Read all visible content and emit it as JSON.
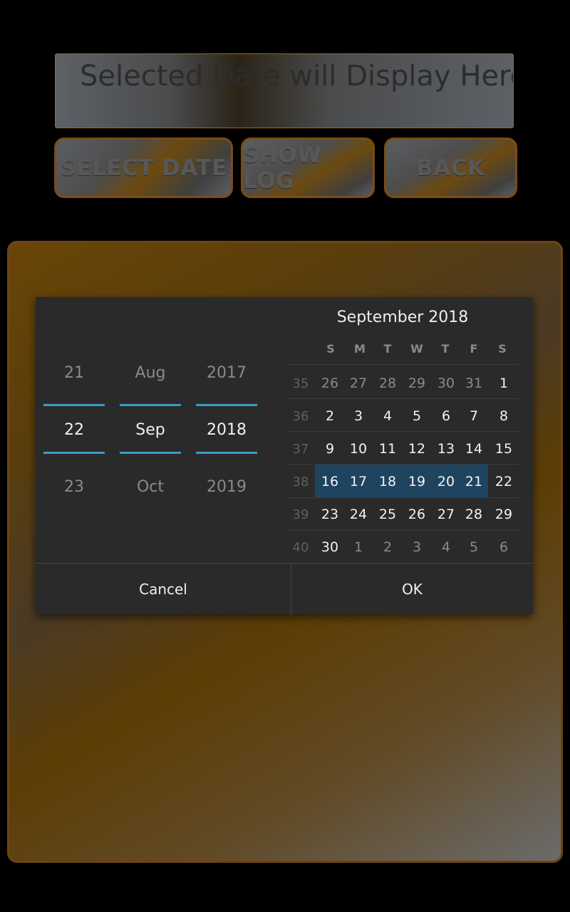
{
  "display": {
    "text": "Selected Date will Display Here"
  },
  "buttons": {
    "select_date": "SELECT DATE",
    "show_log": "SHOW LOG",
    "back": "BACK"
  },
  "picker": {
    "day": {
      "prev": "21",
      "current": "22",
      "next": "23"
    },
    "month": {
      "prev": "Aug",
      "current": "Sep",
      "next": "Oct"
    },
    "year": {
      "prev": "2017",
      "current": "2018",
      "next": "2019"
    }
  },
  "calendar": {
    "title": "September 2018",
    "weekdays": [
      "S",
      "M",
      "T",
      "W",
      "T",
      "F",
      "S"
    ],
    "weeks": [
      {
        "num": "35",
        "days": [
          "26",
          "27",
          "28",
          "29",
          "30",
          "31",
          "1"
        ]
      },
      {
        "num": "36",
        "days": [
          "2",
          "3",
          "4",
          "5",
          "6",
          "7",
          "8"
        ]
      },
      {
        "num": "37",
        "days": [
          "9",
          "10",
          "11",
          "12",
          "13",
          "14",
          "15"
        ]
      },
      {
        "num": "38",
        "days": [
          "16",
          "17",
          "18",
          "19",
          "20",
          "21",
          "22"
        ]
      },
      {
        "num": "39",
        "days": [
          "23",
          "24",
          "25",
          "26",
          "27",
          "28",
          "29"
        ]
      },
      {
        "num": "40",
        "days": [
          "30",
          "1",
          "2",
          "3",
          "4",
          "5",
          "6"
        ]
      }
    ]
  },
  "actions": {
    "cancel": "Cancel",
    "ok": "OK"
  },
  "colors": {
    "accent": "#3a9cc4",
    "selected_week": "#1f4460",
    "border": "#7a4d14"
  }
}
